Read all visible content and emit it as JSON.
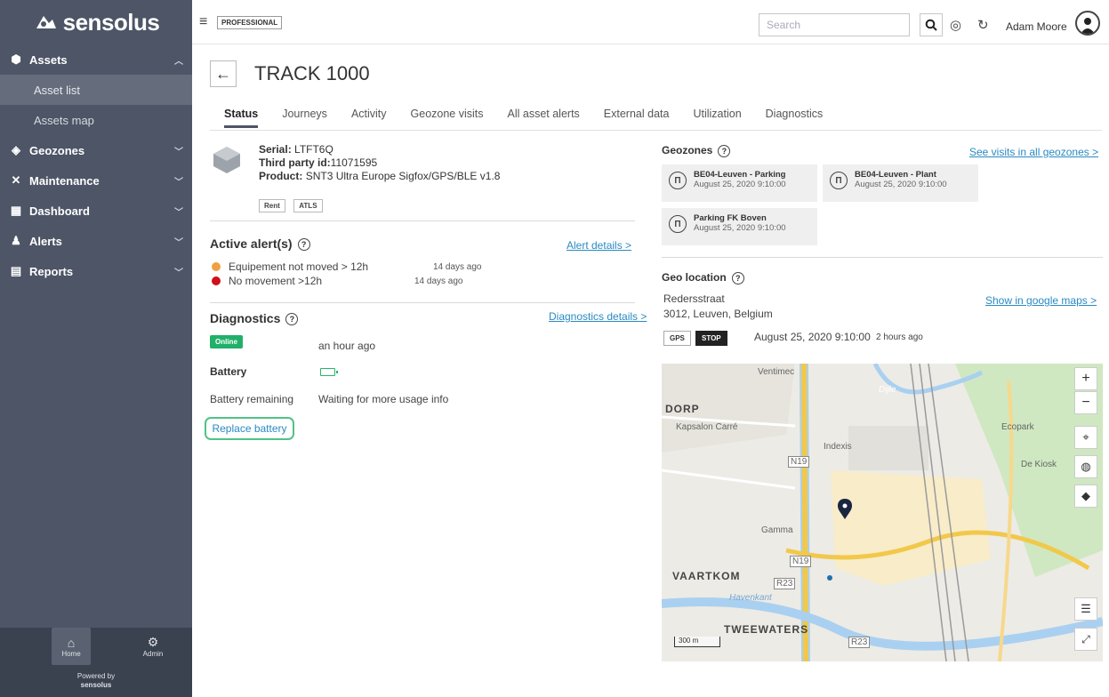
{
  "brand": {
    "name": "sensolus"
  },
  "sidebar": {
    "assets": {
      "label": "Assets",
      "items": [
        {
          "label": "Asset list"
        },
        {
          "label": "Assets map"
        }
      ]
    },
    "geozones": {
      "label": "Geozones"
    },
    "maintenance": {
      "label": "Maintenance"
    },
    "dashboard": {
      "label": "Dashboard"
    },
    "alerts": {
      "label": "Alerts"
    },
    "reports": {
      "label": "Reports"
    },
    "home_label": "Home",
    "admin_label": "Admin",
    "powered_by": "Powered by",
    "powered_brand": "sensolus"
  },
  "topbar": {
    "plan": "PROFESSIONAL",
    "search_placeholder": "Search",
    "user_name": "Adam Moore"
  },
  "asset": {
    "title": "TRACK 1000",
    "serial_label": "Serial:",
    "serial": "LTFT6Q",
    "third_party_label": "Third party id:",
    "third_party": "11071595",
    "product_label": "Product:",
    "product": "SNT3 Ultra Europe Sigfox/GPS/BLE v1.8",
    "tags": [
      "Rent",
      "ATLS"
    ]
  },
  "tabs": [
    "Status",
    "Journeys",
    "Activity",
    "Geozone visits",
    "All asset alerts",
    "External data",
    "Utilization",
    "Diagnostics"
  ],
  "alerts": {
    "title": "Active alert(s)",
    "details_link": "Alert details >",
    "items": [
      {
        "text": "Equipement not moved > 12h",
        "time": "14 days ago",
        "color": "#f0a040"
      },
      {
        "text": "No movement >12h",
        "time": "14 days ago",
        "color": "#d0101a"
      }
    ]
  },
  "diagnostics": {
    "title": "Diagnostics",
    "details_link": "Diagnostics details >",
    "status_badge": "Online",
    "status_time": "an hour ago",
    "battery_label": "Battery",
    "battery_remaining_label": "Battery remaining",
    "battery_remaining_value": "Waiting for more usage info",
    "replace_button": "Replace battery"
  },
  "geozones": {
    "title": "Geozones",
    "link": "See visits in all geozones >",
    "items": [
      {
        "name": "BE04-Leuven - Parking",
        "date": "August 25, 2020 9:10:00"
      },
      {
        "name": "BE04-Leuven - Plant",
        "date": "August 25, 2020 9:10:00"
      },
      {
        "name": "Parking FK Boven",
        "date": "August 25, 2020 9:10:00"
      }
    ]
  },
  "geo_location": {
    "title": "Geo location",
    "street": "Redersstraat",
    "city": "3012, Leuven, Belgium",
    "maps_link": "Show in google maps >",
    "source_tag": "GPS",
    "state_tag": "STOP",
    "timestamp": "August 25, 2020 9:10:00",
    "relative": "2 hours ago"
  },
  "map": {
    "labels": [
      "DORP",
      "Kapsalon Carré",
      "Indexis",
      "Gamma",
      "VAARTKOM",
      "TWEEWATERS",
      "Ecopark",
      "De Kiosk",
      "Ventimec",
      "Dijle",
      "Havenkant",
      "N19",
      "N19",
      "R23",
      "R23"
    ],
    "scale": "300 m"
  }
}
